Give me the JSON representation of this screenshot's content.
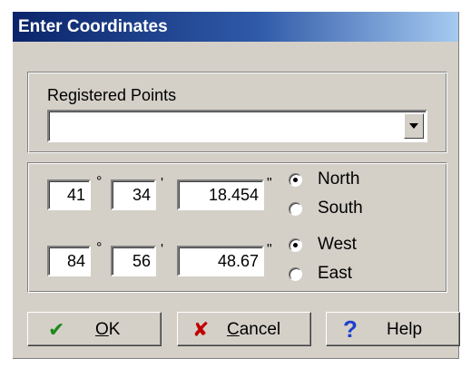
{
  "window": {
    "title": "Enter Coordinates"
  },
  "registered_points": {
    "label": "Registered Points",
    "value": ""
  },
  "latitude": {
    "degrees": "41",
    "minutes": "34",
    "seconds": "18.454",
    "options": [
      "North",
      "South"
    ],
    "selected": "North"
  },
  "longitude": {
    "degrees": "84",
    "minutes": "56",
    "seconds": "48.67",
    "options": [
      "West",
      "East"
    ],
    "selected": "West"
  },
  "symbols": {
    "degree": "°",
    "minute": "'",
    "second": "\""
  },
  "buttons": {
    "ok": {
      "mnemonic": "O",
      "rest": "K"
    },
    "cancel": {
      "mnemonic": "C",
      "rest": "ancel"
    },
    "help": {
      "label": "Help"
    }
  },
  "icons": {
    "ok": "checkmark-icon",
    "cancel": "x-icon",
    "help": "question-icon"
  },
  "colors": {
    "title_start": "#0a246a",
    "title_end": "#a6caf0",
    "ok_icon": "#1a8a1a",
    "cancel_icon": "#c00000",
    "help_icon": "#1e3fcc",
    "face": "#d4d0c8"
  }
}
